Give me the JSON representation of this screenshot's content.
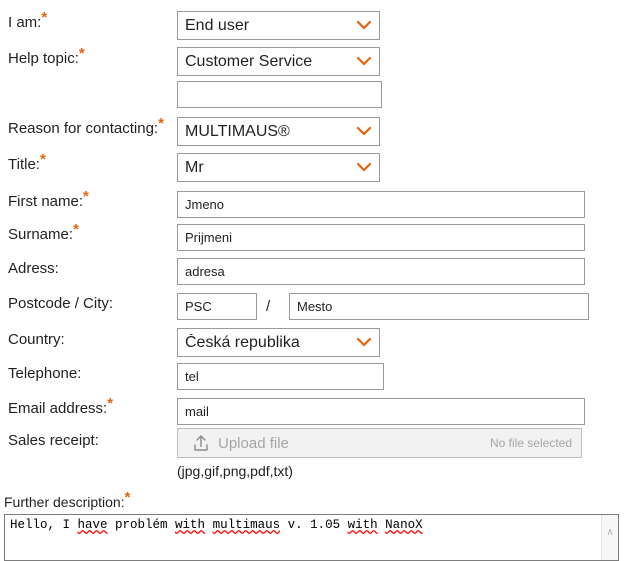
{
  "theme": {
    "required_color": "#e8620c",
    "chevron_color": "#e8620c",
    "field_border": "#9a9a9a",
    "placeholder_color": "#a6a6a6",
    "spellcheck_underline": "#ff0000"
  },
  "form": {
    "rows": [
      {
        "label": "I am:",
        "required": true,
        "type": "select",
        "value": "End user"
      },
      {
        "label": "Help topic:",
        "required": true,
        "type": "select",
        "value": "Customer Service"
      },
      {
        "label": "",
        "required": false,
        "type": "blank",
        "value": ""
      },
      {
        "label": "Reason for contacting:",
        "required": true,
        "type": "select",
        "value": "MULTIMAUS®"
      },
      {
        "label": "Title:",
        "required": true,
        "type": "select",
        "value": "Mr"
      },
      {
        "label": "First name:",
        "required": true,
        "type": "text",
        "value": "Jmeno"
      },
      {
        "label": "Surname:",
        "required": true,
        "type": "text",
        "value": "Prijmeni"
      },
      {
        "label": "Adress:",
        "required": false,
        "type": "text",
        "value": "adresa"
      },
      {
        "label": "Postcode / City:",
        "required": false,
        "type": "split",
        "value": "PSC",
        "value2": "Mesto",
        "separator": "/"
      },
      {
        "label": "Country:",
        "required": false,
        "type": "select",
        "value": "Česká republika"
      },
      {
        "label": "Telephone:",
        "required": false,
        "type": "text",
        "value": "tel"
      },
      {
        "label": "Email address:",
        "required": true,
        "type": "text",
        "value": "mail"
      },
      {
        "label": "Sales receipt:",
        "required": false,
        "type": "upload",
        "value": ""
      }
    ],
    "upload": {
      "button_label": "Upload file",
      "status": "No file selected",
      "icon": "upload-icon",
      "allowed_types": "(jpg,gif,png,pdf,txt)"
    },
    "description": {
      "label": "Further description:",
      "required": true,
      "value": "Hello, I have problém with multimaus v. 1.05 with NanoX",
      "segments": [
        {
          "text": "Hello, I ",
          "misspelled": false
        },
        {
          "text": "have",
          "misspelled": true
        },
        {
          "text": " problém ",
          "misspelled": false
        },
        {
          "text": "with",
          "misspelled": true
        },
        {
          "text": " ",
          "misspelled": false
        },
        {
          "text": "multimaus",
          "misspelled": true
        },
        {
          "text": " v. 1.05 ",
          "misspelled": false
        },
        {
          "text": "with",
          "misspelled": true
        },
        {
          "text": " ",
          "misspelled": false
        },
        {
          "text": "NanoX",
          "misspelled": true
        }
      ],
      "scroll_up_arrow": "∧"
    }
  }
}
